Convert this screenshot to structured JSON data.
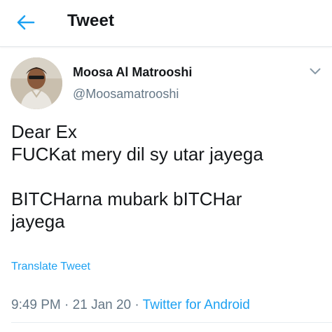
{
  "header": {
    "back_icon": "arrow-left-icon",
    "title": "Tweet",
    "accent_color": "#1da1f2"
  },
  "author": {
    "display_name": "Moosa Al Matrooshi",
    "handle": "@Moosamatrooshi"
  },
  "tweet": {
    "lines": [
      "Dear Ex",
      "FUCKat mery dil sy utar jayega",
      "",
      "BITCHarna mubark bITCHar",
      "jayega"
    ],
    "translate_label": "Translate Tweet",
    "time": "9:49 PM",
    "separator": "·",
    "date": "21 Jan 20",
    "source": "Twitter for Android"
  },
  "colors": {
    "text": "#14171a",
    "secondary": "#657786",
    "link": "#1da1f2"
  }
}
